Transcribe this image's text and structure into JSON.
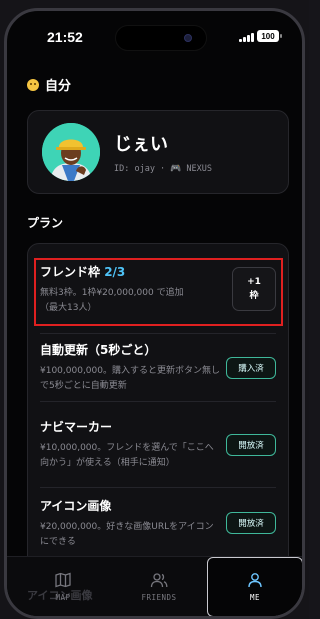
{
  "status_bar": {
    "time": "21:52",
    "battery": "100"
  },
  "self_section": {
    "icon": "smiley-face-icon",
    "title": "自分"
  },
  "profile": {
    "name": "じぇい",
    "id_text": "ID: ojay ·",
    "team_icon": "gamepad-icon",
    "team": "NEXUS"
  },
  "plan_section": {
    "title": "プラン"
  },
  "plans": [
    {
      "title": "フレンド枠",
      "count": "2/3",
      "desc_line1": "無料3枠。1枠¥20,000,000 で追加",
      "desc_line2": "（最大13人）",
      "button_line1": "+1",
      "button_line2": "枠"
    },
    {
      "title": "自動更新（5秒ごと）",
      "desc": "¥100,000,000。購入すると更新ボタン無しで5秒ごとに自動更新",
      "button": "購入済"
    },
    {
      "title": "ナビマーカー",
      "desc": "¥10,000,000。フレンドを選んで「ここへ向かう」が使える（相手に通知）",
      "button": "開放済"
    },
    {
      "title": "アイコン画像",
      "desc": "¥20,000,000。好きな画像URLをアイコンにできる",
      "button": "開放済"
    }
  ],
  "behind_tabbar_text": "アイコン画像",
  "tabs": [
    {
      "label": "MAP",
      "icon": "map-icon",
      "active": false
    },
    {
      "label": "FRIENDS",
      "icon": "people-icon",
      "active": false
    },
    {
      "label": "ME",
      "icon": "person-icon",
      "active": true
    }
  ],
  "colors": {
    "accent_count": "#4fc3f7",
    "highlight": "#e02020",
    "owned_border": "#3fb89a"
  }
}
